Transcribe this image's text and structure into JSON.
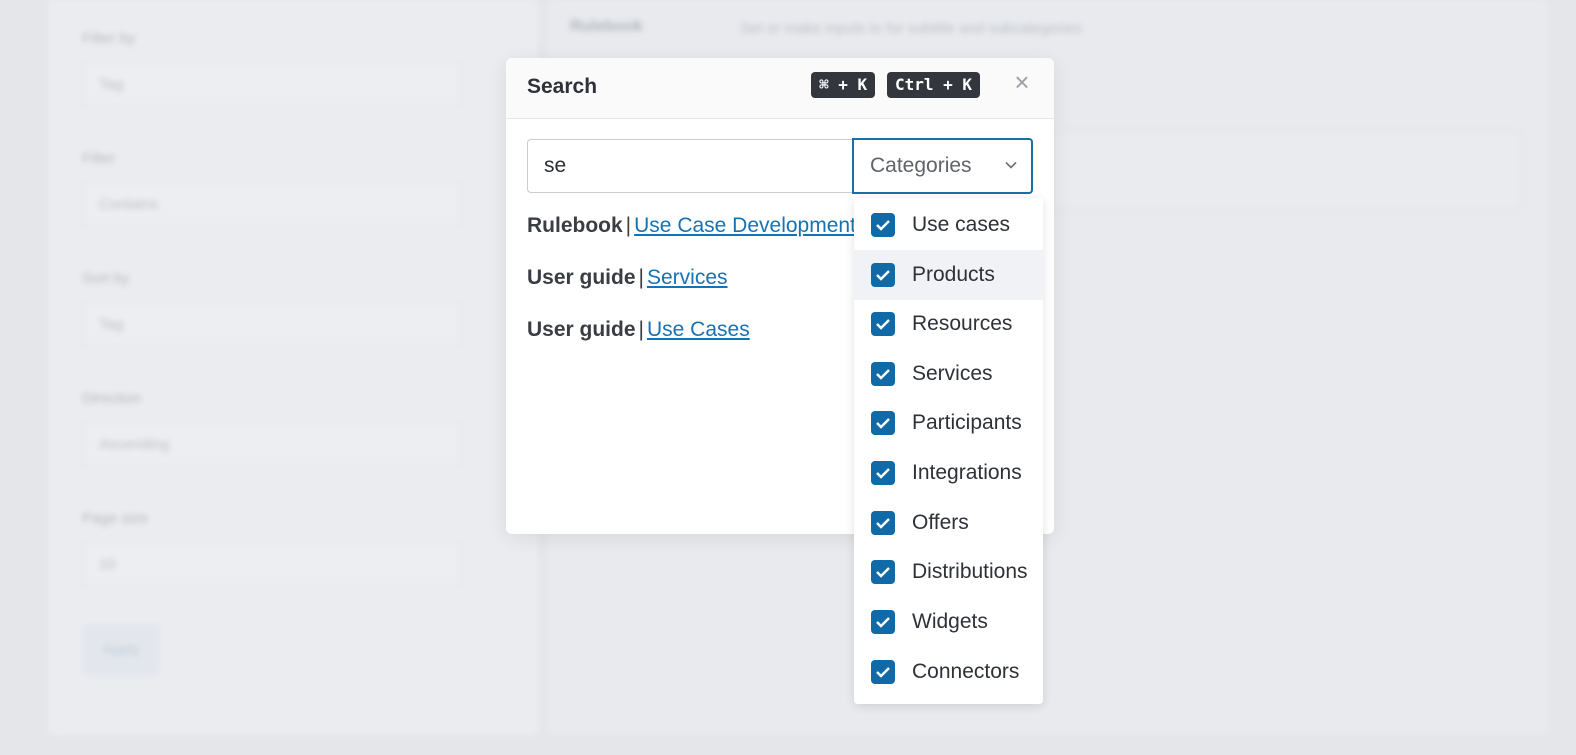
{
  "background": {
    "fields": [
      {
        "label": "Filter by",
        "value": "Tag"
      },
      {
        "label": "Filter",
        "value": "Contains"
      },
      {
        "label": "Sort by",
        "value": "Tag"
      },
      {
        "label": "Direction",
        "value": "Ascending"
      },
      {
        "label": "Page size",
        "value": "10"
      }
    ],
    "apply_label": "Apply",
    "heading": "Rulebook",
    "subheading": "Set or make inputs to for subtitle and subcategories"
  },
  "modal": {
    "title": "Search",
    "shortcut_mac": "⌘ + K",
    "shortcut_pc": "Ctrl + K",
    "close_icon": "×"
  },
  "search": {
    "value": "se",
    "categories_label": "Categories"
  },
  "results": [
    {
      "category": "Rulebook",
      "separator": "|",
      "link": "Use Case Development"
    },
    {
      "category": "User guide",
      "separator": "|",
      "link": "Services"
    },
    {
      "category": "User guide",
      "separator": "|",
      "link": "Use Cases"
    }
  ],
  "categories": [
    {
      "label": "Use cases",
      "checked": true
    },
    {
      "label": "Products",
      "checked": true
    },
    {
      "label": "Resources",
      "checked": true
    },
    {
      "label": "Services",
      "checked": true
    },
    {
      "label": "Participants",
      "checked": true
    },
    {
      "label": "Integrations",
      "checked": true
    },
    {
      "label": "Offers",
      "checked": true
    },
    {
      "label": "Distributions",
      "checked": true
    },
    {
      "label": "Widgets",
      "checked": true
    },
    {
      "label": "Connectors",
      "checked": true
    }
  ],
  "colors": {
    "accent": "#0f6aa7",
    "link": "#1673b3",
    "backdrop": "#e4e6ea"
  }
}
